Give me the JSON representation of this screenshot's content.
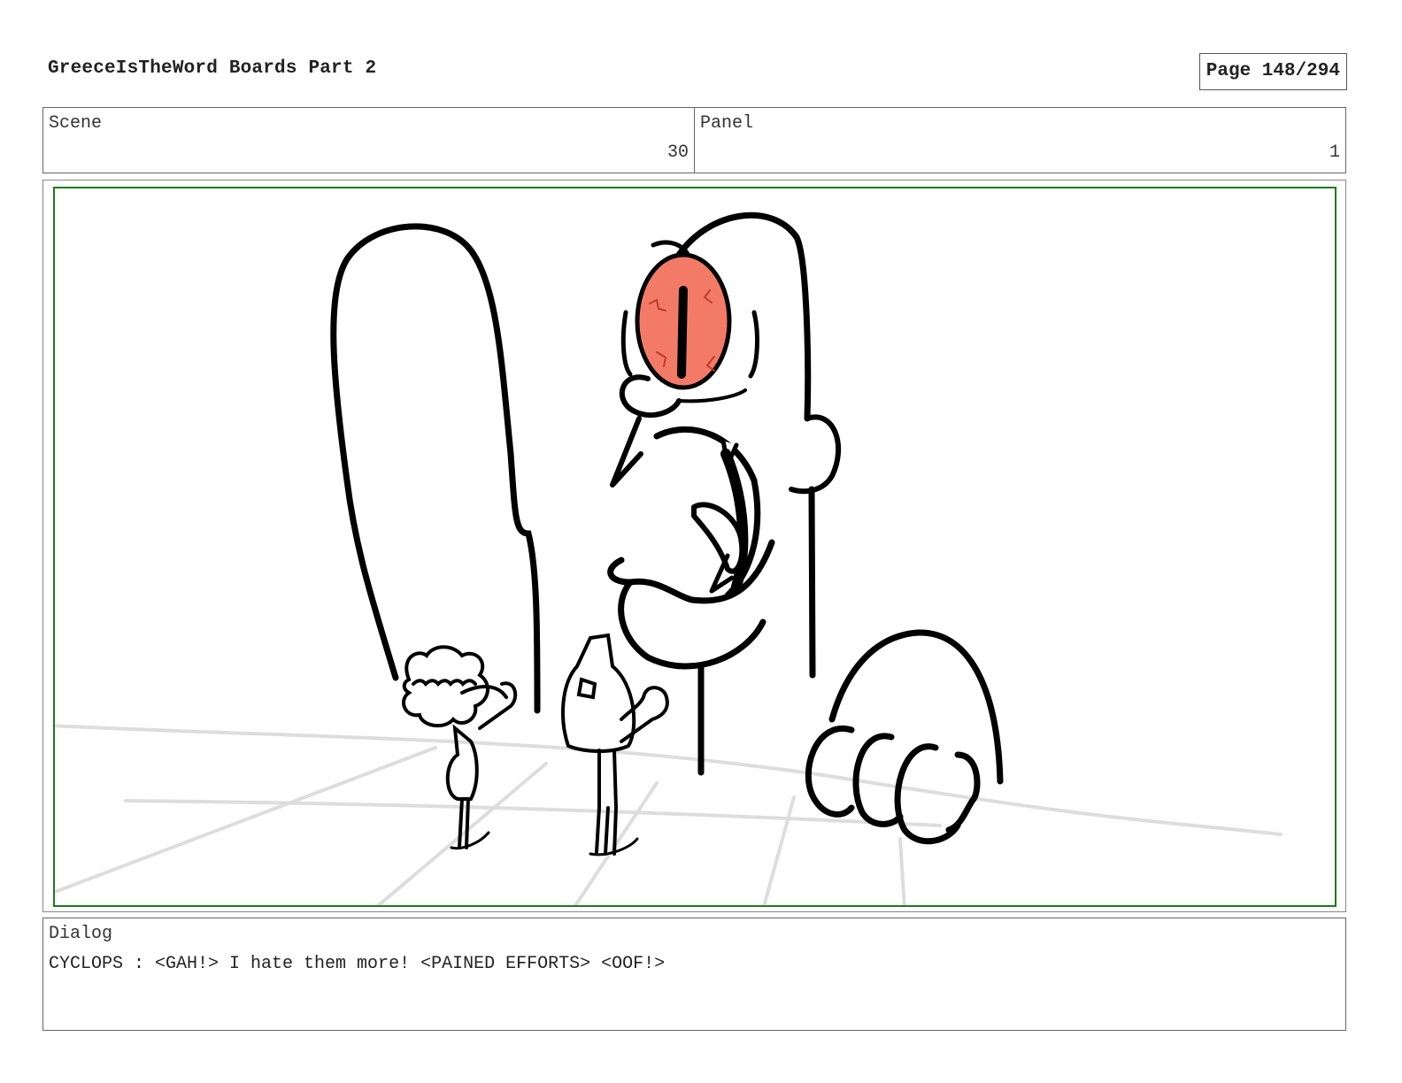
{
  "header": {
    "title": "GreeceIsTheWord Boards Part 2",
    "page": "Page 148/294"
  },
  "info": {
    "scene_label": "Scene",
    "scene_value": "30",
    "panel_label": "Panel",
    "panel_value": "1"
  },
  "dialog": {
    "label": "Dialog",
    "text": "CYCLOPS : <GAH!> I hate them more! <PAINED EFFORTS> <OOF!>"
  },
  "colors": {
    "panel_border": "#1e7a1e",
    "eye": "#f47a68",
    "floor": "#dddddd",
    "ink": "#000000"
  }
}
